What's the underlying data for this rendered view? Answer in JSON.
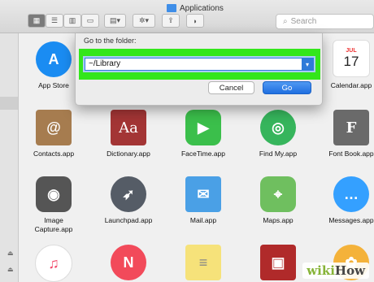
{
  "window": {
    "title": "Applications",
    "search_placeholder": "Search"
  },
  "toolbar": {
    "view_icons": [
      "icon-view-icon",
      "list-view-icon",
      "column-view-icon",
      "gallery-view-icon"
    ],
    "group_icon": "group-icon",
    "action_icon": "gear-icon",
    "share_icon": "share-icon",
    "tag_icon": "tag-icon",
    "sidebar_marks": [
      "⏏",
      "⏏"
    ]
  },
  "dialog": {
    "title": "Go to the folder:",
    "path_value": "~/Library",
    "cancel_label": "Cancel",
    "go_label": "Go",
    "highlight_color": "#33e61b"
  },
  "apps": [
    {
      "label": "App Store",
      "icon": "app-store-icon",
      "color": "#1a8cf2",
      "glyph": "A"
    },
    {
      "label": "Calendar.app",
      "icon": "calendar-icon",
      "color": "#ffffff",
      "glyph": "17",
      "sub": "JUL"
    },
    {
      "label": "Contacts.app",
      "icon": "contacts-icon",
      "color": "#a67c4f",
      "glyph": "@"
    },
    {
      "label": "Dictionary.app",
      "icon": "dictionary-icon",
      "color": "#a33535",
      "glyph": "Aa"
    },
    {
      "label": "FaceTime.app",
      "icon": "facetime-icon",
      "color": "#3bbf4b",
      "glyph": "▶"
    },
    {
      "label": "Find My.app",
      "icon": "find-my-icon",
      "color": "#36b55c",
      "glyph": "◎"
    },
    {
      "label": "Font Book.app",
      "icon": "font-book-icon",
      "color": "#6a6a6a",
      "glyph": "F"
    },
    {
      "label": "Image\nCapture.app",
      "icon": "image-capture-icon",
      "color": "#555555",
      "glyph": "◉"
    },
    {
      "label": "Launchpad.app",
      "icon": "launchpad-icon",
      "color": "#555c66",
      "glyph": "🚀"
    },
    {
      "label": "Mail.app",
      "icon": "mail-icon",
      "color": "#4aa0e6",
      "glyph": "✉"
    },
    {
      "label": "Maps.app",
      "icon": "maps-icon",
      "color": "#6fbf5f",
      "glyph": "⌖"
    },
    {
      "label": "Messages.app",
      "icon": "messages-icon",
      "color": "#34a0ff",
      "glyph": "…"
    },
    {
      "label": "",
      "icon": "music-icon",
      "color": "#f24a6a",
      "glyph": "♫"
    },
    {
      "label": "",
      "icon": "news-icon",
      "color": "#f24a5a",
      "glyph": "N"
    },
    {
      "label": "",
      "icon": "notes-icon",
      "color": "#f6e27a",
      "glyph": "≡"
    },
    {
      "label": "",
      "icon": "photo-booth-icon",
      "color": "#b02a2a",
      "glyph": "▣"
    },
    {
      "label": "",
      "icon": "photos-icon",
      "color": "#f4b23a",
      "glyph": "✿"
    }
  ],
  "watermark": {
    "part1": "wiki",
    "part2": "How"
  }
}
